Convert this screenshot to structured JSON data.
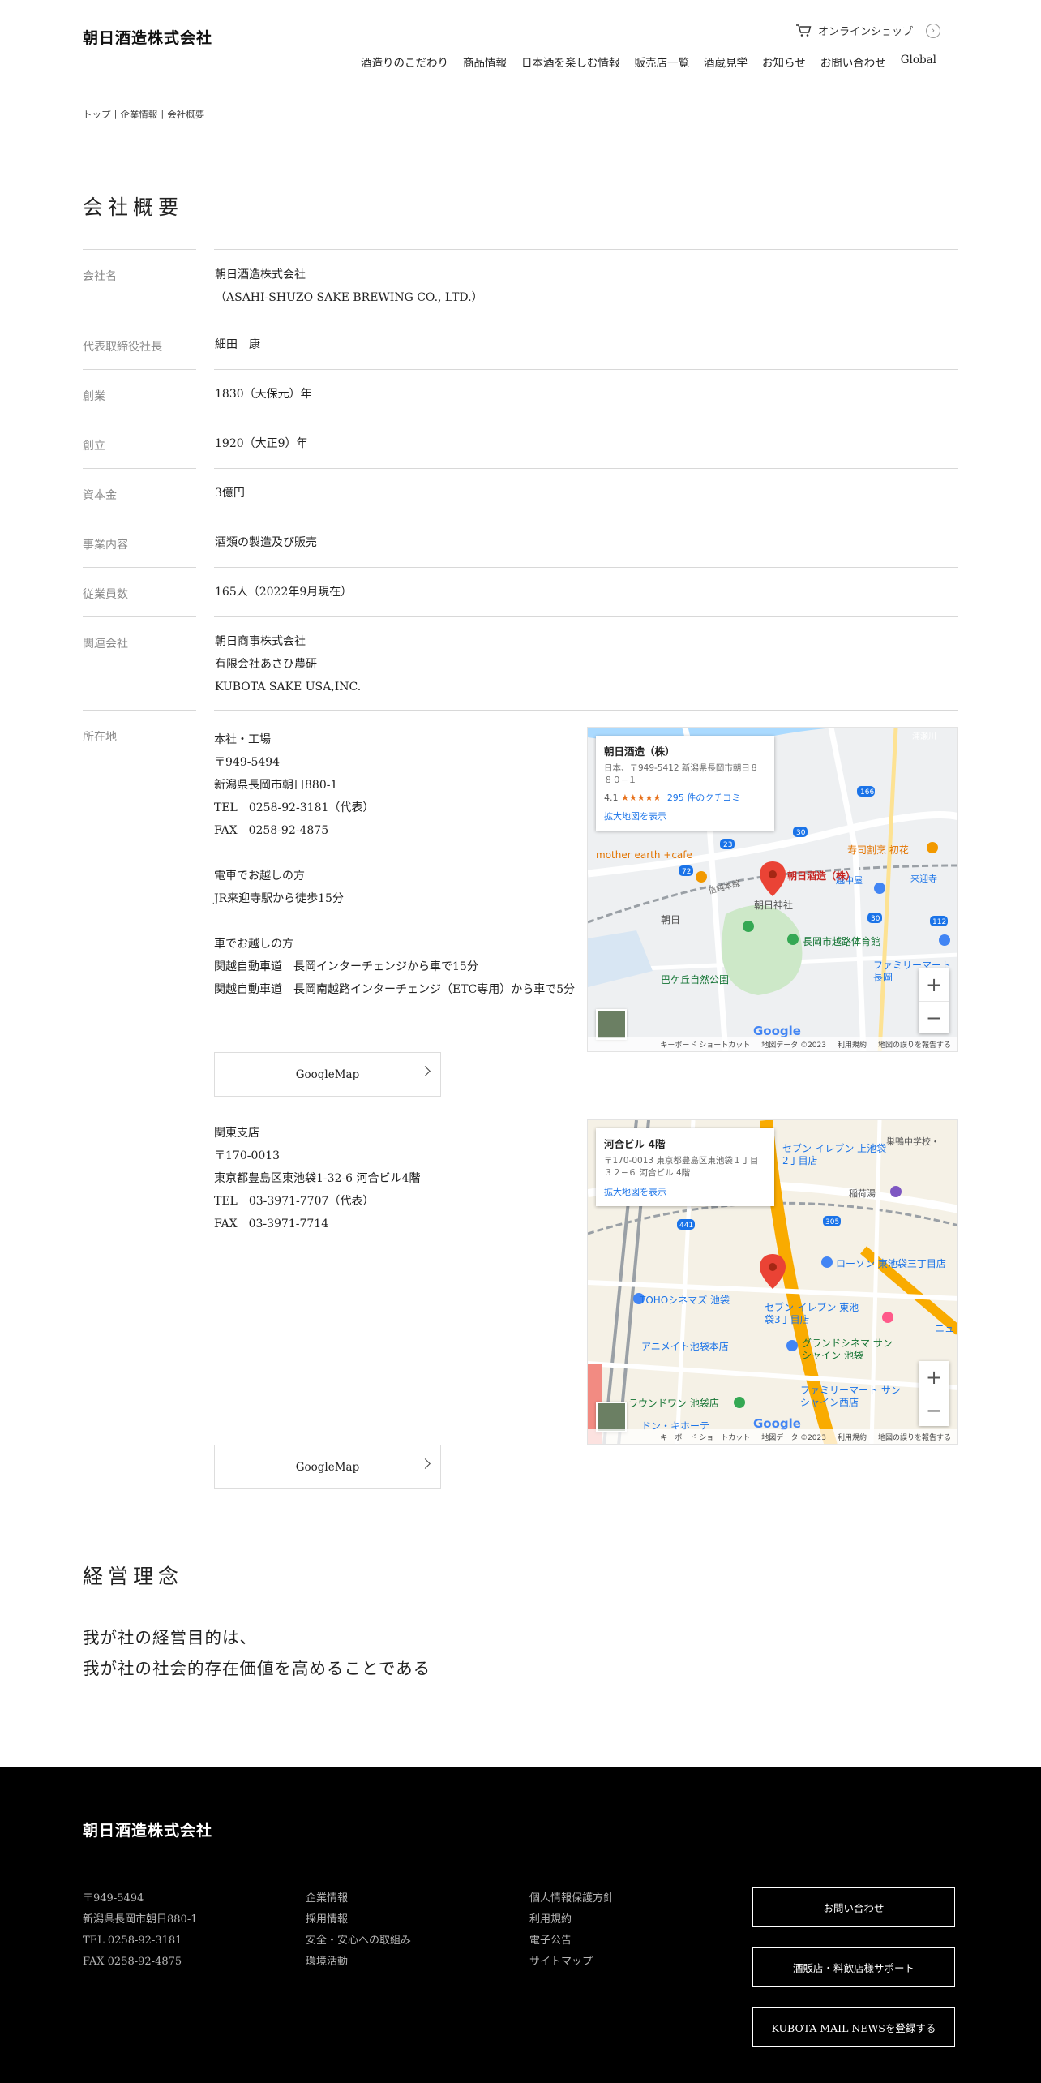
{
  "header": {
    "logo": "朝日酒造株式会社",
    "online_shop": "オンラインショップ",
    "nav": [
      "酒造りのこだわり",
      "商品情報",
      "日本酒を楽しむ情報",
      "販売店一覧",
      "酒蔵見学",
      "お知らせ",
      "お問い合わせ",
      "Global"
    ]
  },
  "breadcrumb": [
    "トップ",
    "企業情報",
    "会社概要"
  ],
  "overview": {
    "title": "会社概要",
    "rows": [
      {
        "label": "会社名",
        "lines": [
          "朝日酒造株式会社",
          "（ASAHI-SHUZO SAKE BREWING CO., LTD.）"
        ]
      },
      {
        "label": "代表取締役社長",
        "lines": [
          "細田　康"
        ]
      },
      {
        "label": "創業",
        "lines": [
          "1830（天保元）年"
        ]
      },
      {
        "label": "創立",
        "lines": [
          "1920（大正9）年"
        ]
      },
      {
        "label": "資本金",
        "lines": [
          "3億円"
        ]
      },
      {
        "label": "事業内容",
        "lines": [
          "酒類の製造及び販売"
        ]
      },
      {
        "label": "従業員数",
        "lines": [
          "165人（2022年9月現在）"
        ]
      },
      {
        "label": "関連会社",
        "lines": [
          "朝日商事株式会社",
          "有限会社あさひ農研",
          "KUBOTA SAKE USA,INC."
        ]
      }
    ],
    "location_label": "所在地",
    "hq": {
      "lines_a": [
        "本社・工場",
        "〒949-5494",
        "新潟県長岡市朝日880-1",
        "TEL　0258-92-3181（代表）",
        "FAX　0258-92-4875"
      ],
      "lines_b": [
        "電車でお越しの方",
        "JR来迎寺駅から徒歩15分"
      ],
      "lines_c": [
        "車でお越しの方",
        "関越自動車道　長岡インターチェンジから車で15分",
        "関越自動車道　長岡南越路インターチェンジ（ETC専用）から車で5分"
      ]
    },
    "kanto": {
      "lines": [
        "関東支店",
        "〒170-0013",
        "東京都豊島区東池袋1-32-6 河合ビル4階",
        "TEL　03-3971-7707（代表）",
        "FAX　03-3971-7714"
      ]
    },
    "googlemap_label": "GoogleMap",
    "map1": {
      "place": "朝日酒造（株）",
      "address": "日本、〒949-5412 新潟県長岡市朝日８８０−１",
      "rating": "4.1",
      "stars": "★★★★★",
      "reviews": "295 件のクチコミ",
      "link": "拡大地図を表示",
      "labels": [
        "mother earth +cafe",
        "寿司割烹 初花",
        "越中屋",
        "来迎寺",
        "朝日酒造（株）",
        "朝日神社",
        "朝日",
        "長岡市越路体育館",
        "巴ケ丘自然公園",
        "ファミリーマート 長岡",
        "信越本線",
        "浦瀬川"
      ],
      "road_numbers": [
        "166",
        "30",
        "23",
        "72",
        "30",
        "112"
      ],
      "shortcut": "キーボード ショートカット",
      "data": "地図データ ©2023",
      "terms": "利用規約",
      "report": "地図の誤りを報告する",
      "google": "Google"
    },
    "map2": {
      "place": "河合ビル 4階",
      "address": "〒170-0013 東京都豊島区東池袋１丁目３２−６ 河合ビル 4階",
      "link": "拡大地図を表示",
      "labels": [
        "セブン-イレブン 上池袋2丁目店",
        "巣鴨中学校・",
        "稲荷湯",
        "ローソン 東池袋三丁目店",
        "TOHOシネマズ 池袋",
        "セブン-イレブン 東池袋3丁目店",
        "アニメイト池袋本店",
        "グランドシネマ サンシャイン 池袋",
        "ラウンドワン 池袋店",
        "ファミリーマート サンシャイン西店",
        "ドン・キホーテ",
        "ニュ"
      ],
      "road_numbers": [
        "305",
        "441"
      ],
      "shortcut": "キーボード ショートカット",
      "data": "地図データ ©2023",
      "terms": "利用規約",
      "report": "地図の誤りを報告する",
      "google": "Google"
    }
  },
  "philosophy": {
    "title": "経営理念",
    "line1": "我が社の経営目的は、",
    "line2": "我が社の社会的存在価値を高めることである"
  },
  "footer": {
    "logo": "朝日酒造株式会社",
    "address": [
      "〒949-5494",
      "新潟県長岡市朝日880-1",
      "TEL 0258-92-3181",
      "FAX 0258-92-4875"
    ],
    "links1": [
      "企業情報",
      "採用情報",
      "安全・安心への取組み",
      "環境活動"
    ],
    "links2": [
      "個人情報保護方針",
      "利用規約",
      "電子公告",
      "サイトマップ"
    ],
    "buttons": [
      "お問い合わせ",
      "酒販店・料飲店様サポート",
      "KUBOTA MAIL NEWSを登録する"
    ]
  }
}
